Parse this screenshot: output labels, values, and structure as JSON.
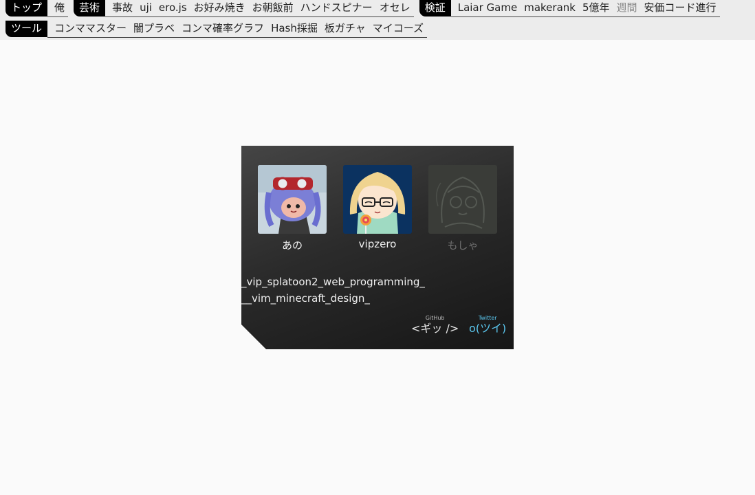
{
  "nav": {
    "row1": [
      {
        "label": "トップ",
        "links": [
          {
            "text": "俺"
          }
        ]
      },
      {
        "label": "芸術",
        "links": [
          {
            "text": "事故"
          },
          {
            "text": "uji"
          },
          {
            "text": "ero.js"
          },
          {
            "text": "お好み焼き"
          },
          {
            "text": "お朝飯前"
          },
          {
            "text": "ハンドスピナー"
          },
          {
            "text": "オセレ"
          }
        ]
      },
      {
        "label": "検証",
        "links": [
          {
            "text": "Laiar Game"
          },
          {
            "text": "makerank"
          },
          {
            "text": "5億年"
          },
          {
            "text": "週間",
            "muted": true
          },
          {
            "text": "安価コード進行"
          }
        ]
      }
    ],
    "row2": [
      {
        "label": "ツール",
        "links": [
          {
            "text": "コンママスター"
          },
          {
            "text": "闇プラベ"
          },
          {
            "text": "コンマ確率グラフ"
          },
          {
            "text": "Hash採掘"
          },
          {
            "text": "板ガチャ"
          },
          {
            "text": "マイコーズ"
          }
        ]
      }
    ]
  },
  "card": {
    "members": [
      {
        "name": "あの",
        "icon": "squid-avatar-icon"
      },
      {
        "name": "vipzero",
        "icon": "anime-girl-avatar-icon"
      },
      {
        "name": "もしゃ",
        "icon": "sketch-avatar-icon",
        "dim": true
      }
    ],
    "tags": [
      "_vip_splatoon2_web_programming_",
      "__vim_minecraft_design_"
    ],
    "github": {
      "small": "GitHub",
      "big": "<ギッ />"
    },
    "twitter": {
      "small": "Twitter",
      "big": "o(ツイ)"
    }
  }
}
